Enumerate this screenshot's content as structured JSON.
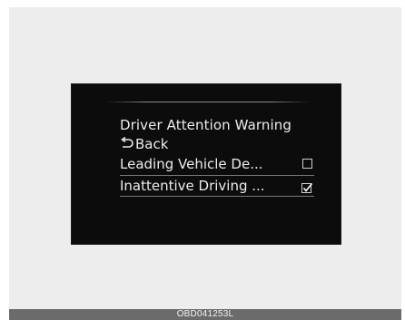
{
  "menu": {
    "title": "Driver Attention Warning",
    "items": [
      {
        "label": "Back",
        "icon": "back-arrow-icon"
      },
      {
        "label": "Leading Vehicle De...",
        "checked": false
      },
      {
        "label": "Inattentive Driving ...",
        "checked": true,
        "selected": true
      }
    ]
  },
  "caption": "OBD041253L",
  "colors": {
    "screen_background": "#0c0c0c",
    "text": "#ececec",
    "caption_bar": "#6b6b6b"
  }
}
